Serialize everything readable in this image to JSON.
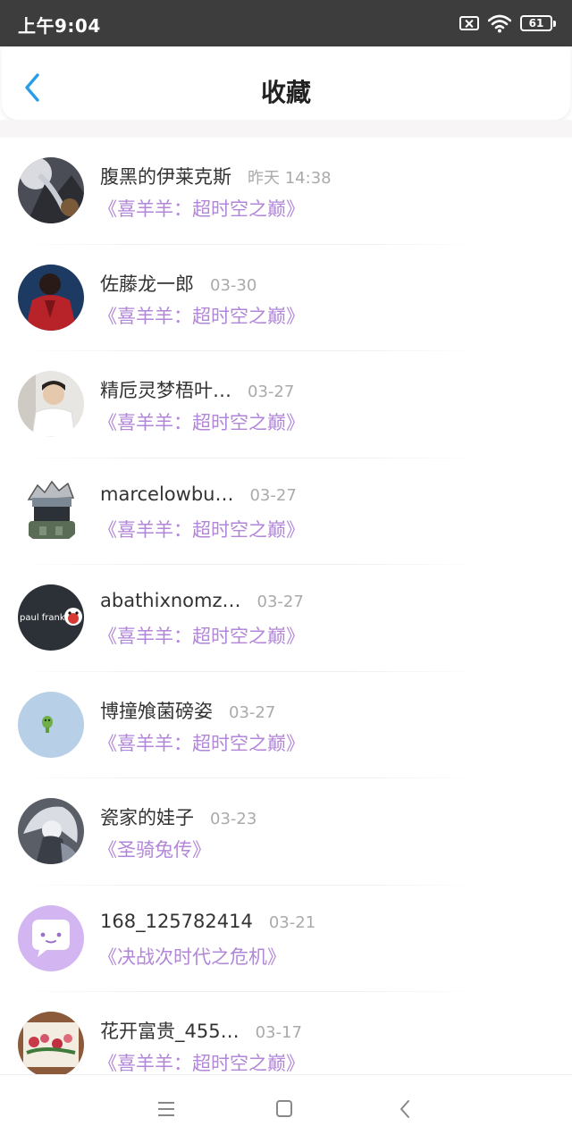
{
  "status_bar": {
    "time": "上午9:04",
    "battery": "61",
    "icons": [
      "no-sim-icon",
      "wifi-icon",
      "battery-icon"
    ]
  },
  "header": {
    "title": "收藏",
    "back_icon": "chevron-left-icon",
    "accent_color": "#2a9de8"
  },
  "colors": {
    "work_title": "#b286d8",
    "user_name": "#333333",
    "date": "#aaaaaa"
  },
  "favorites": [
    {
      "user": "腹黑的伊莱克斯",
      "date": "昨天 14:38",
      "work": "《喜羊羊：超时空之巅》"
    },
    {
      "user": "佐藤龙一郎",
      "date": "03-30",
      "work": "《喜羊羊：超时空之巅》"
    },
    {
      "user": "精卮灵梦梧叶…",
      "date": "03-27",
      "work": "《喜羊羊：超时空之巅》"
    },
    {
      "user": "marcelowbu…",
      "date": "03-27",
      "work": "《喜羊羊：超时空之巅》"
    },
    {
      "user": "abathixnomz…",
      "date": "03-27",
      "work": "《喜羊羊：超时空之巅》",
      "avatar_text": "paul frank."
    },
    {
      "user": "博撞飧菌磅姿",
      "date": "03-27",
      "work": "《喜羊羊：超时空之巅》"
    },
    {
      "user": "瓷家的娃子",
      "date": "03-23",
      "work": "《圣骑兔传》"
    },
    {
      "user": "168_125782414",
      "date": "03-21",
      "work": "《决战次时代之危机》"
    },
    {
      "user": "花开富贵_455…",
      "date": "03-17",
      "work": "《喜羊羊：超时空之巅》"
    }
  ],
  "nav_bar": {
    "buttons": [
      "menu-icon",
      "home-square-icon",
      "back-triangle-icon"
    ]
  }
}
